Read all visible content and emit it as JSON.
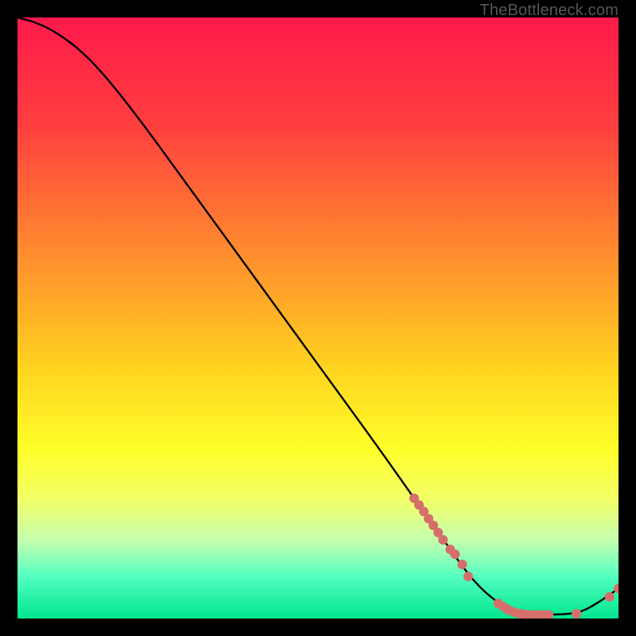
{
  "watermark": "TheBottleneck.com",
  "chart_data": {
    "type": "line",
    "title": "",
    "xlabel": "",
    "ylabel": "",
    "xlim": [
      0,
      100
    ],
    "ylim": [
      0,
      100
    ],
    "gradient_stops": [
      {
        "pct": 0,
        "color": "#ff1a4b"
      },
      {
        "pct": 18,
        "color": "#ff3f3f"
      },
      {
        "pct": 40,
        "color": "#ff8f2e"
      },
      {
        "pct": 58,
        "color": "#ffd21f"
      },
      {
        "pct": 72,
        "color": "#ffff2a"
      },
      {
        "pct": 80,
        "color": "#f3ff66"
      },
      {
        "pct": 87,
        "color": "#c6ffb0"
      },
      {
        "pct": 93,
        "color": "#54ffc0"
      },
      {
        "pct": 100,
        "color": "#00e58f"
      }
    ],
    "curve": [
      {
        "x": 0,
        "y": 100.0
      },
      {
        "x": 3,
        "y": 99.2
      },
      {
        "x": 6,
        "y": 97.8
      },
      {
        "x": 10,
        "y": 95.0
      },
      {
        "x": 14,
        "y": 91.0
      },
      {
        "x": 20,
        "y": 83.5
      },
      {
        "x": 28,
        "y": 72.5
      },
      {
        "x": 36,
        "y": 61.5
      },
      {
        "x": 44,
        "y": 50.5
      },
      {
        "x": 52,
        "y": 39.5
      },
      {
        "x": 60,
        "y": 28.5
      },
      {
        "x": 66,
        "y": 20.0
      },
      {
        "x": 72,
        "y": 11.5
      },
      {
        "x": 76,
        "y": 6.0
      },
      {
        "x": 80,
        "y": 2.5
      },
      {
        "x": 83,
        "y": 1.0
      },
      {
        "x": 88,
        "y": 0.6
      },
      {
        "x": 93,
        "y": 0.8
      },
      {
        "x": 96,
        "y": 2.2
      },
      {
        "x": 100,
        "y": 5.0
      }
    ],
    "dot_clusters": [
      {
        "x": 66.0,
        "y": 20.0
      },
      {
        "x": 66.8,
        "y": 18.9
      },
      {
        "x": 67.6,
        "y": 17.8
      },
      {
        "x": 68.4,
        "y": 16.6
      },
      {
        "x": 69.2,
        "y": 15.5
      },
      {
        "x": 70.0,
        "y": 14.3
      },
      {
        "x": 70.8,
        "y": 13.1
      },
      {
        "x": 72.0,
        "y": 11.5
      },
      {
        "x": 72.8,
        "y": 10.7
      },
      {
        "x": 74.0,
        "y": 9.0
      },
      {
        "x": 75.0,
        "y": 7.0
      },
      {
        "x": 80.0,
        "y": 2.5
      },
      {
        "x": 80.8,
        "y": 2.0
      },
      {
        "x": 81.4,
        "y": 1.6
      },
      {
        "x": 82.0,
        "y": 1.3
      },
      {
        "x": 82.8,
        "y": 1.0
      },
      {
        "x": 83.6,
        "y": 0.8
      },
      {
        "x": 84.4,
        "y": 0.7
      },
      {
        "x": 85.2,
        "y": 0.6
      },
      {
        "x": 86.0,
        "y": 0.6
      },
      {
        "x": 86.8,
        "y": 0.6
      },
      {
        "x": 87.6,
        "y": 0.6
      },
      {
        "x": 88.4,
        "y": 0.6
      },
      {
        "x": 93.0,
        "y": 0.8
      },
      {
        "x": 98.5,
        "y": 3.6
      },
      {
        "x": 100.0,
        "y": 5.0
      }
    ],
    "dot_color": "#d66f6b",
    "dot_radius_px": 6
  }
}
